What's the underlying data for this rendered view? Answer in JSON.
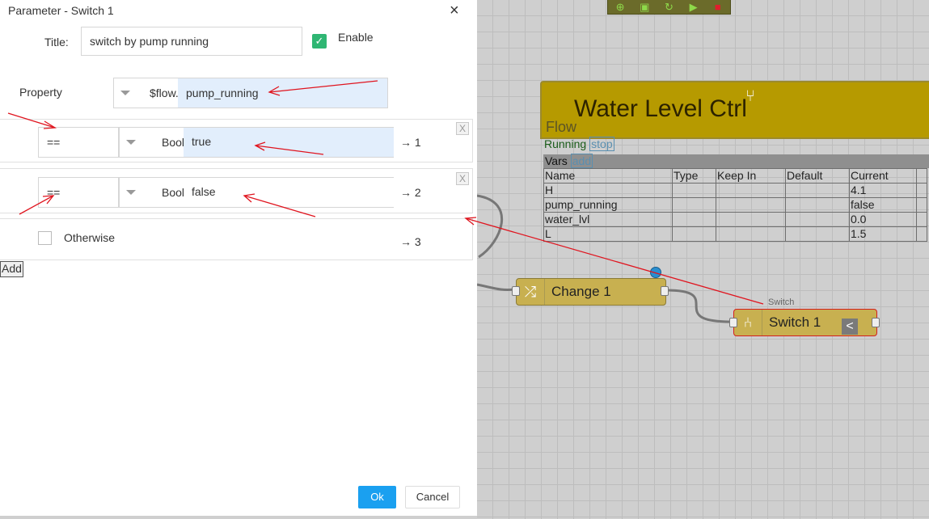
{
  "dialog": {
    "title": "Parameter - Switch 1",
    "close_icon": "×",
    "title_label": "Title:",
    "title_value": "switch by pump running",
    "enable_label": "Enable",
    "enable_checked": true,
    "property_label": "Property",
    "property_prefix": "$flow.",
    "property_value": "pump_running",
    "rules": [
      {
        "operator": "==",
        "type": "Bool",
        "value": "true",
        "output": "→ 1",
        "remove": "X"
      },
      {
        "operator": "==",
        "type": "Bool",
        "value": "false",
        "output": "→ 2",
        "remove": "X"
      }
    ],
    "otherwise_label": "Otherwise",
    "otherwise_output": "→ 3",
    "add_label": "Add",
    "ok_label": "Ok",
    "cancel_label": "Cancel"
  },
  "canvas": {
    "block_title": "Water Level Ctrl",
    "flow_label": "Flow",
    "status": "Running",
    "stop_label": "stop",
    "vars_label": "Vars",
    "vars_add_label": "add",
    "vars_columns": [
      "Name",
      "Type",
      "Keep In",
      "Default",
      "Current",
      ""
    ],
    "vars_rows": [
      {
        "name": "H",
        "type": "",
        "keep_in": "",
        "default": "",
        "current": "4.1"
      },
      {
        "name": "pump_running",
        "type": "",
        "keep_in": "",
        "default": "",
        "current": "false"
      },
      {
        "name": "water_lvl",
        "type": "",
        "keep_in": "",
        "default": "",
        "current": "0.0"
      },
      {
        "name": "L",
        "type": "",
        "keep_in": "",
        "default": "",
        "current": "1.5"
      }
    ],
    "nodes": {
      "change": {
        "label": "Change 1",
        "icon": "shuffle-icon"
      },
      "switch": {
        "label": "Switch 1",
        "tag": "Switch",
        "icon": "switch-branch-icon",
        "back": "<"
      }
    },
    "toolbar_icons": [
      "target-icon",
      "save-icon",
      "refresh-icon",
      "play-icon",
      "stop-icon"
    ]
  },
  "colors": {
    "block": "#b69a00",
    "node": "#c8b050",
    "ok_button": "#1aa0f0",
    "checkbox": "#2fb673",
    "annotation_arrows": "#e0141e"
  }
}
